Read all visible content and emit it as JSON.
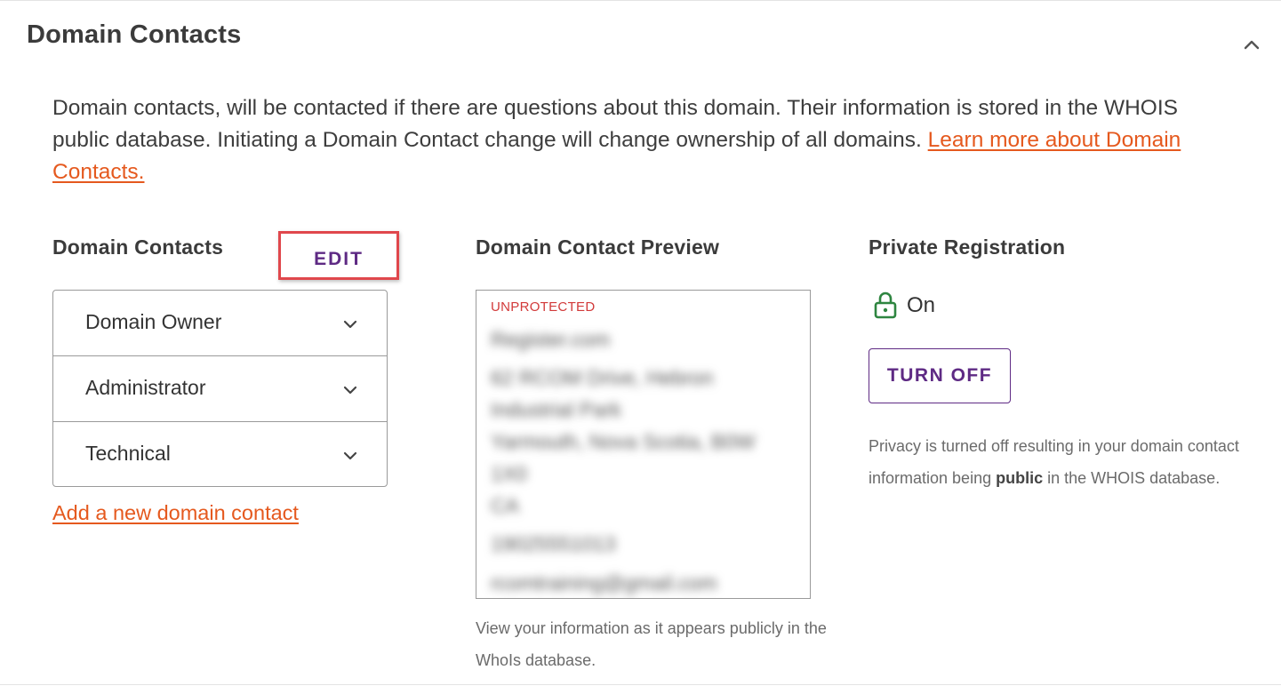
{
  "header": {
    "title": "Domain Contacts"
  },
  "intro": {
    "text": "Domain contacts, will be contacted if there are questions about this domain. Their information is stored in the WHOIS public database. Initiating a Domain Contact change will change ownership of all domains. ",
    "link_text": "Learn more about Domain Contacts."
  },
  "contacts": {
    "heading": "Domain Contacts",
    "edit_label": "EDIT",
    "items": [
      {
        "label": "Domain Owner"
      },
      {
        "label": "Administrator"
      },
      {
        "label": "Technical"
      }
    ],
    "add_link": "Add a new domain contact"
  },
  "preview": {
    "heading": "Domain Contact Preview",
    "status": "UNPROTECTED",
    "lines": [
      "Register.com",
      "62 RCOM Drive, Hebron",
      "Industrial Park",
      "Yarmouth, Nova Scotia, B0W",
      "1X0",
      "CA",
      "19025551013",
      "rcomtraining@gmail.com"
    ],
    "caption": "View your information as it appears publicly in the WhoIs database."
  },
  "privacy": {
    "heading": "Private Registration",
    "status": "On",
    "button_label": "TURN OFF",
    "note_before": "Privacy is turned off resulting in your domain contact information being ",
    "note_bold": "public",
    "note_after": " in the WHOIS database."
  },
  "colors": {
    "accent_link": "#e5591e",
    "brand_purple": "#5e2a84",
    "lock_green": "#2e8540",
    "status_red": "#d23a3a",
    "highlight_red": "#e0474c"
  },
  "icons": {
    "collapse": "chevron-up-icon",
    "expand": "chevron-down-icon",
    "lock": "lock-icon"
  }
}
